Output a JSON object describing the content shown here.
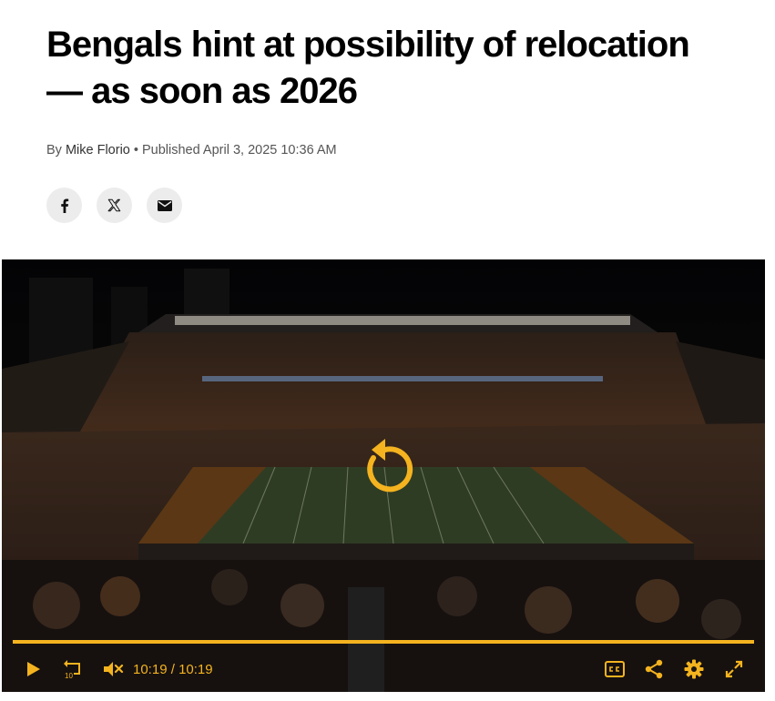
{
  "article": {
    "headline": "Bengals hint at possibility of relocation — as soon as 2026",
    "byline_prefix": "By",
    "author": "Mike Florio",
    "separator": "•",
    "published": "Published April 3, 2025 10:36 AM"
  },
  "share": {
    "icons": [
      "facebook-icon",
      "x-icon",
      "email-icon"
    ]
  },
  "video": {
    "accent_color": "#f4b31f",
    "progress": 1.0,
    "current_time": "10:19",
    "time_separator": "/",
    "duration": "10:19",
    "state": "ended",
    "muted": true,
    "skip_back_seconds": "10",
    "controls": [
      "play-icon",
      "rewind-10-icon",
      "mute-icon",
      "captions-icon",
      "share-icon",
      "settings-icon",
      "fullscreen-icon"
    ]
  }
}
